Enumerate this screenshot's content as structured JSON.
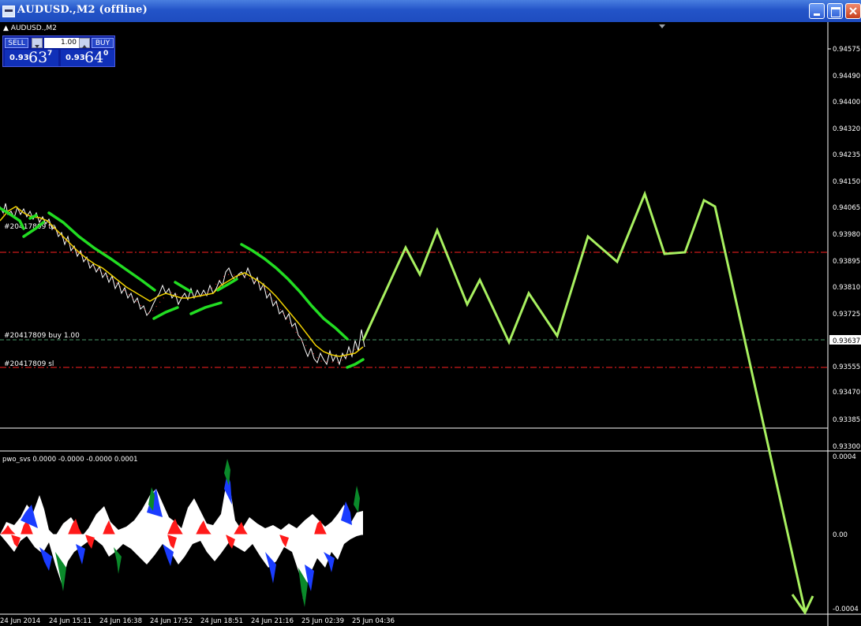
{
  "window": {
    "title": "AUDUSD.,M2 (offline)",
    "icons": {
      "app": "chart-window-icon",
      "minimize": "minimize-icon",
      "maximize": "maximize-icon",
      "close": "close-icon"
    }
  },
  "chart": {
    "symbol_label": "AUDUSD.,M2",
    "colors": {
      "background": "#000000",
      "price_line": "#ffffff",
      "tp_sl_line": "#ff2020",
      "ma_fast": "#f0d000",
      "ma_slow": "#22dd22",
      "projection": "#a8f060",
      "axis_text": "#ffffff"
    }
  },
  "one_click": {
    "sell_label": "SELL",
    "buy_label": "BUY",
    "lot": "1.00",
    "sell_price_big": "0.93",
    "sell_price_pips": "63",
    "sell_price_sup": "7",
    "buy_price_big": "0.93",
    "buy_price_pips": "64",
    "buy_price_sup": "0"
  },
  "orders": {
    "tp_label": "#20417809 tp",
    "buy_label": "#20417809 buy 1.00",
    "sl_label": "#20417809 sl"
  },
  "price_axis": {
    "ticks": [
      "0.94575",
      "0.94490",
      "0.94400",
      "0.94320",
      "0.94235",
      "0.94150",
      "0.94065",
      "0.93980",
      "0.93895",
      "0.93810",
      "0.93725",
      "0.93637",
      "0.93555",
      "0.93470",
      "0.93385",
      "0.93300"
    ],
    "current_price": "0.93637"
  },
  "indicator": {
    "label": "pwo_svs 0.0000 -0.0000 -0.0000 0.0001",
    "ticks": [
      "0.0004",
      "0.00",
      "-0.0004"
    ],
    "colors": {
      "positive": "#ff1a1a",
      "negative": "#1a3cff",
      "alt": "#0a8a2a",
      "base": "#ffffff"
    }
  },
  "time_axis": {
    "ticks": [
      "24 Jun 2014",
      "24 Jun 15:11",
      "24 Jun 16:38",
      "24 Jun 17:52",
      "24 Jun 18:51",
      "24 Jun 21:16",
      "25 Jun 02:39",
      "25 Jun 04:36"
    ]
  }
}
